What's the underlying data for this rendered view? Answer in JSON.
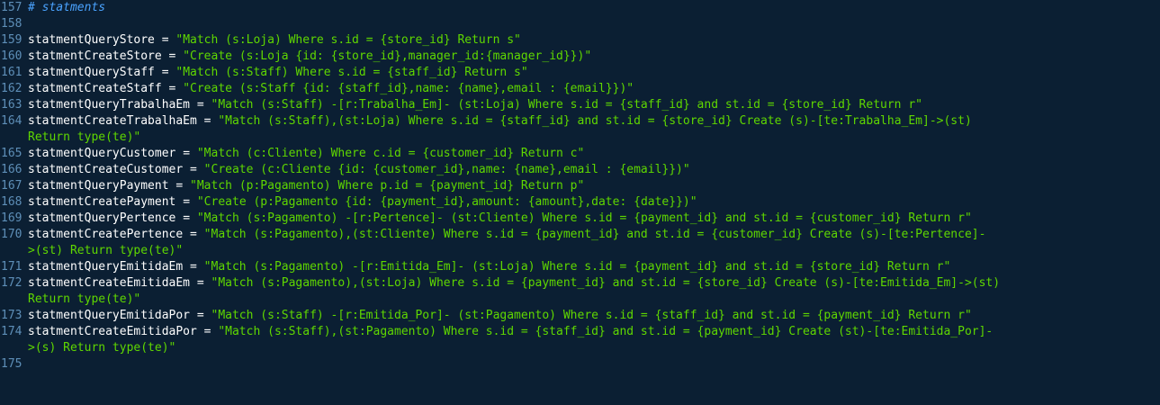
{
  "editor": {
    "lines": [
      {
        "num": "157",
        "type": "comment",
        "text": "# statments"
      },
      {
        "num": "158",
        "type": "blank"
      },
      {
        "num": "159",
        "type": "assign",
        "var": "statmentQueryStore",
        "op": " = ",
        "str": "\"Match (s:Loja) Where s.id = {store_id} Return s\""
      },
      {
        "num": "160",
        "type": "assign",
        "var": "statmentCreateStore",
        "op": " = ",
        "str": "\"Create (s:Loja {id: {store_id},manager_id:{manager_id}})\""
      },
      {
        "num": "161",
        "type": "assign",
        "var": "statmentQueryStaff",
        "op": " = ",
        "str": "\"Match (s:Staff) Where s.id = {staff_id} Return s\""
      },
      {
        "num": "162",
        "type": "assign",
        "var": "statmentCreateStaff",
        "op": " = ",
        "str": "\"Create (s:Staff {id: {staff_id},name: {name},email : {email}})\""
      },
      {
        "num": "163",
        "type": "assign",
        "var": "statmentQueryTrabalhaEm",
        "op": " = ",
        "str": "\"Match (s:Staff) -[r:Trabalha_Em]- (st:Loja) Where s.id = {staff_id} and st.id = {store_id} Return r\""
      },
      {
        "num": "164",
        "type": "wrap",
        "var": "statmentCreateTrabalhaEm",
        "op": " = ",
        "str": "\"Match (s:Staff),(st:Loja) Where s.id = {staff_id} and st.id = {store_id} Create (s)-[te:Trabalha_Em]->(st)",
        "cont": "Return type(te)\""
      },
      {
        "num": "165",
        "type": "assign",
        "var": "statmentQueryCustomer",
        "op": " = ",
        "str": "\"Match (c:Cliente) Where c.id = {customer_id} Return c\""
      },
      {
        "num": "166",
        "type": "assign",
        "var": "statmentCreateCustomer",
        "op": " = ",
        "str": "\"Create (c:Cliente {id: {customer_id},name: {name},email : {email}})\""
      },
      {
        "num": "167",
        "type": "assign",
        "var": "statmentQueryPayment",
        "op": " = ",
        "str": "\"Match (p:Pagamento) Where p.id = {payment_id} Return p\""
      },
      {
        "num": "168",
        "type": "assign",
        "var": "statmentCreatePayment",
        "op": " = ",
        "str": "\"Create (p:Pagamento {id: {payment_id},amount: {amount},date: {date}})\""
      },
      {
        "num": "169",
        "type": "assign",
        "var": "statmentQueryPertence",
        "op": " = ",
        "str": "\"Match (s:Pagamento) -[r:Pertence]- (st:Cliente) Where s.id = {payment_id} and st.id = {customer_id} Return r\""
      },
      {
        "num": "170",
        "type": "wrap",
        "var": "statmentCreatePertence",
        "op": " = ",
        "str": "\"Match (s:Pagamento),(st:Cliente) Where s.id = {payment_id} and st.id = {customer_id} Create (s)-[te:Pertence]-",
        "cont": ">(st) Return type(te)\""
      },
      {
        "num": "171",
        "type": "assign",
        "var": "statmentQueryEmitidaEm",
        "op": " = ",
        "str": "\"Match (s:Pagamento) -[r:Emitida_Em]- (st:Loja) Where s.id = {payment_id} and st.id = {store_id} Return r\""
      },
      {
        "num": "172",
        "type": "wrap",
        "var": "statmentCreateEmitidaEm",
        "op": " = ",
        "str": "\"Match (s:Pagamento),(st:Loja) Where s.id = {payment_id} and st.id = {store_id} Create (s)-[te:Emitida_Em]->(st)",
        "cont": "Return type(te)\""
      },
      {
        "num": "173",
        "type": "assign",
        "var": "statmentQueryEmitidaPor",
        "op": " = ",
        "str": "\"Match (s:Staff) -[r:Emitida_Por]- (st:Pagamento) Where s.id = {staff_id} and st.id = {payment_id} Return r\""
      },
      {
        "num": "174",
        "type": "wrap",
        "var": "statmentCreateEmitidaPor",
        "op": " = ",
        "str": "\"Match (s:Staff),(st:Pagamento) Where s.id = {staff_id} and st.id = {payment_id} Create (st)-[te:Emitida_Por]-",
        "cont": ">(s) Return type(te)\""
      },
      {
        "num": "175",
        "type": "blank"
      }
    ]
  }
}
